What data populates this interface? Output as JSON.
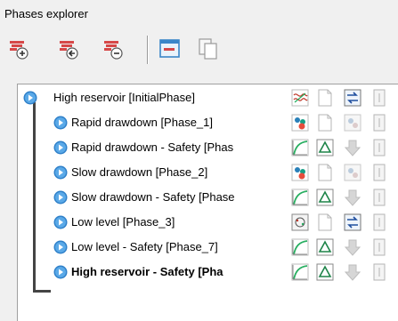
{
  "panel": {
    "title": "Phases explorer"
  },
  "toolbar": {
    "buttons": [
      {
        "name": "add-phase-button",
        "icon": "add-phase-icon"
      },
      {
        "name": "insert-phase-button",
        "icon": "insert-phase-icon"
      },
      {
        "name": "delete-phase-button",
        "icon": "delete-phase-icon"
      },
      {
        "name": "edit-phase-button",
        "icon": "edit-phase-icon"
      },
      {
        "name": "copy-phase-button",
        "icon": "copy-phase-icon"
      }
    ]
  },
  "phases": [
    {
      "label": "High reservoir [InitialPhase]",
      "bold": false,
      "indent": 0,
      "icons": [
        "initial-stress-icon",
        "page-icon",
        "flow-icon",
        "col4-icon"
      ]
    },
    {
      "label": "Rapid drawdown [Phase_1]",
      "bold": false,
      "indent": 1,
      "icons": [
        "consolidation-icon",
        "page-icon",
        "flow-faded-icon",
        "col4-icon"
      ]
    },
    {
      "label": "Rapid drawdown - Safety [Phas",
      "bold": false,
      "indent": 1,
      "icons": [
        "safety-curve-icon",
        "delta-icon",
        "arrow-down-icon",
        "col4-icon"
      ]
    },
    {
      "label": "Slow drawdown [Phase_2]",
      "bold": false,
      "indent": 1,
      "icons": [
        "consolidation-icon",
        "page-icon",
        "flow-faded-icon",
        "col4-icon"
      ]
    },
    {
      "label": "Slow drawdown - Safety [Phase",
      "bold": false,
      "indent": 1,
      "icons": [
        "safety-curve-icon",
        "delta-icon",
        "arrow-down-icon",
        "col4-icon"
      ]
    },
    {
      "label": "Low level [Phase_3]",
      "bold": false,
      "indent": 1,
      "icons": [
        "plastic-icon",
        "page-icon",
        "flow-icon",
        "col4-icon"
      ]
    },
    {
      "label": "Low level - Safety [Phase_7]",
      "bold": false,
      "indent": 1,
      "icons": [
        "safety-curve-icon",
        "delta-icon",
        "arrow-down-icon",
        "col4-icon"
      ]
    },
    {
      "label": "High reservoir - Safety [Pha",
      "bold": true,
      "indent": 1,
      "icons": [
        "safety-curve-icon",
        "delta-icon",
        "arrow-down-icon",
        "col4-icon"
      ]
    }
  ]
}
